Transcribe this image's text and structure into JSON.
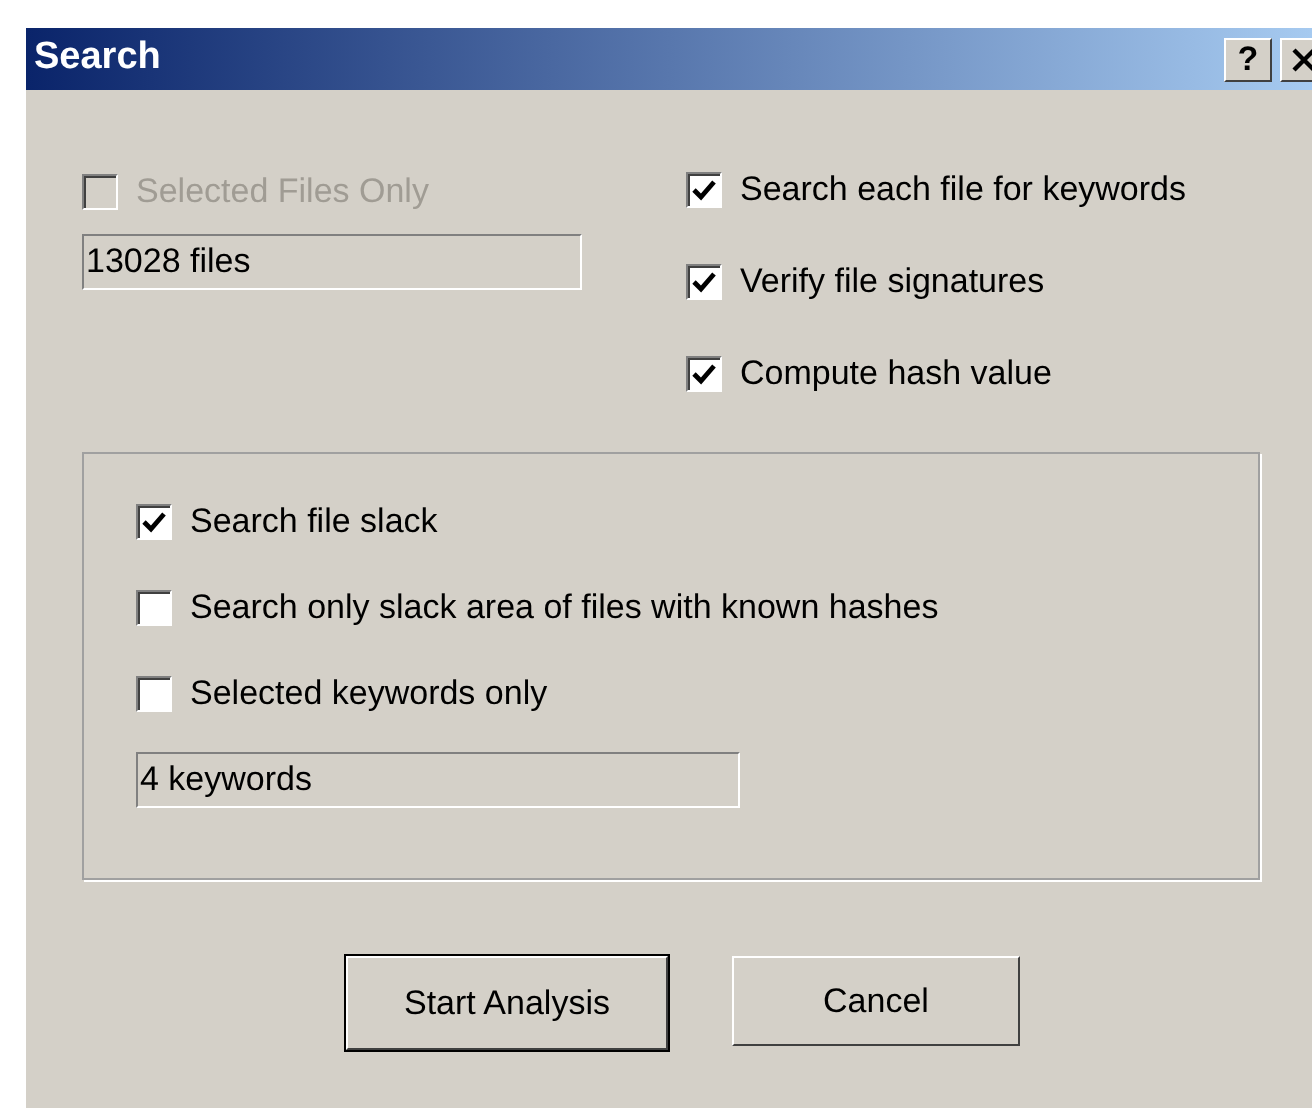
{
  "window": {
    "title": "Search",
    "help_button": "?"
  },
  "scope": {
    "option": {
      "label": "Selected Files Only",
      "checked": false,
      "disabled": true
    },
    "field": {
      "value": "13028 files"
    }
  },
  "options": [
    {
      "label": "Search each file for keywords",
      "checked": true
    },
    {
      "label": "Verify file signatures",
      "checked": true
    },
    {
      "label": "Compute hash value",
      "checked": true
    }
  ],
  "slack_group": {
    "options": [
      {
        "label": "Search file slack",
        "checked": true
      },
      {
        "label": "Search only slack area of files with known hashes",
        "checked": false
      },
      {
        "label": "Selected keywords only",
        "checked": false
      }
    ],
    "field": {
      "value": "4 keywords"
    }
  },
  "buttons": [
    {
      "label": "Start Analysis",
      "default": true
    },
    {
      "label": "Cancel",
      "default": false
    }
  ]
}
